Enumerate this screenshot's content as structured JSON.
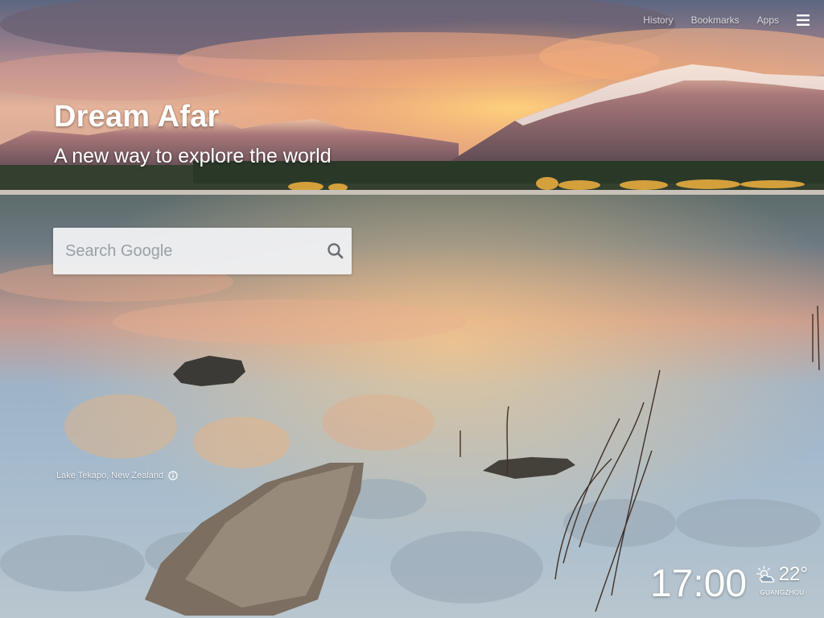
{
  "nav": {
    "history_label": "History",
    "bookmarks_label": "Bookmarks",
    "apps_label": "Apps",
    "menu_icon": "hamburger-menu-icon"
  },
  "brand": {
    "title": "Dream Afar",
    "tagline": "A new way to explore the world"
  },
  "search": {
    "placeholder": "Search Google",
    "value": "",
    "icon": "search-icon"
  },
  "photo": {
    "location": "Lake Tekapo, New Zealand",
    "location_icon": "info-icon"
  },
  "clock": {
    "time": "17:00"
  },
  "weather": {
    "condition_icon": "partly-cloudy-icon",
    "temperature": "22°",
    "city": "GUANGZHOU"
  }
}
